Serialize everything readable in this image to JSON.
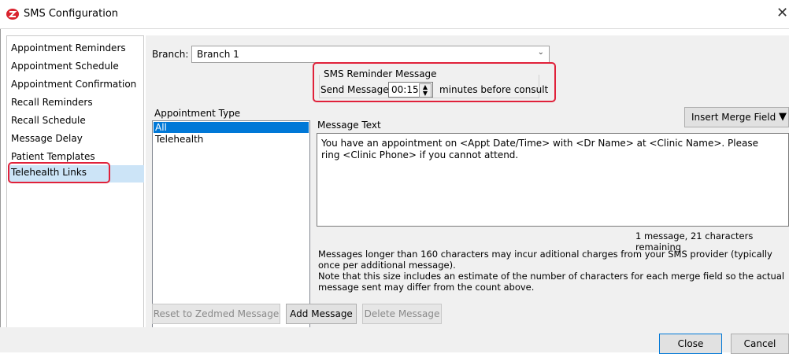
{
  "window": {
    "title": "SMS Configuration",
    "close_glyph": "✕",
    "brand_color": "#d9232e"
  },
  "sidebar": {
    "items": [
      {
        "label": "Appointment Reminders"
      },
      {
        "label": "Appointment Schedule"
      },
      {
        "label": "Appointment Confirmation"
      },
      {
        "label": "Recall Reminders"
      },
      {
        "label": "Recall Schedule"
      },
      {
        "label": "Message Delay"
      },
      {
        "label": "Patient Templates"
      },
      {
        "label": "Telehealth Links"
      }
    ],
    "selected_index": 7
  },
  "branch": {
    "label": "Branch:",
    "value": "Branch 1"
  },
  "reminder": {
    "group_title": "SMS Reminder Message",
    "send_label": "Send Message",
    "minutes_value": "00:15",
    "suffix": "minutes before consult"
  },
  "appointment_type": {
    "label": "Appointment Type",
    "items": [
      "All",
      "Telehealth"
    ],
    "selected_index": 0
  },
  "insert_merge": {
    "label": "Insert Merge Field",
    "arrow": "▼"
  },
  "message": {
    "label": "Message Text",
    "text": "You have an appointment on <Appt Date/Time> with <Dr Name> at <Clinic Name>. Please ring <Clinic Phone> if you cannot attend.",
    "counter": "1 message, 21 characters remaining"
  },
  "notes": {
    "line1": "Messages longer than 160 characters may incur aditional charges from your SMS provider (typically once per additional message).",
    "line2": "Note that this size includes an estimate of the number of characters for each merge field so the actual message sent may differ from the count above."
  },
  "buttons": {
    "reset": "Reset to Zedmed Message",
    "add": "Add Message",
    "delete": "Delete Message",
    "close": "Close",
    "cancel": "Cancel"
  },
  "colors": {
    "highlight": "#e0213a",
    "selection": "#cce4f7",
    "list_selection": "#0078d7"
  }
}
